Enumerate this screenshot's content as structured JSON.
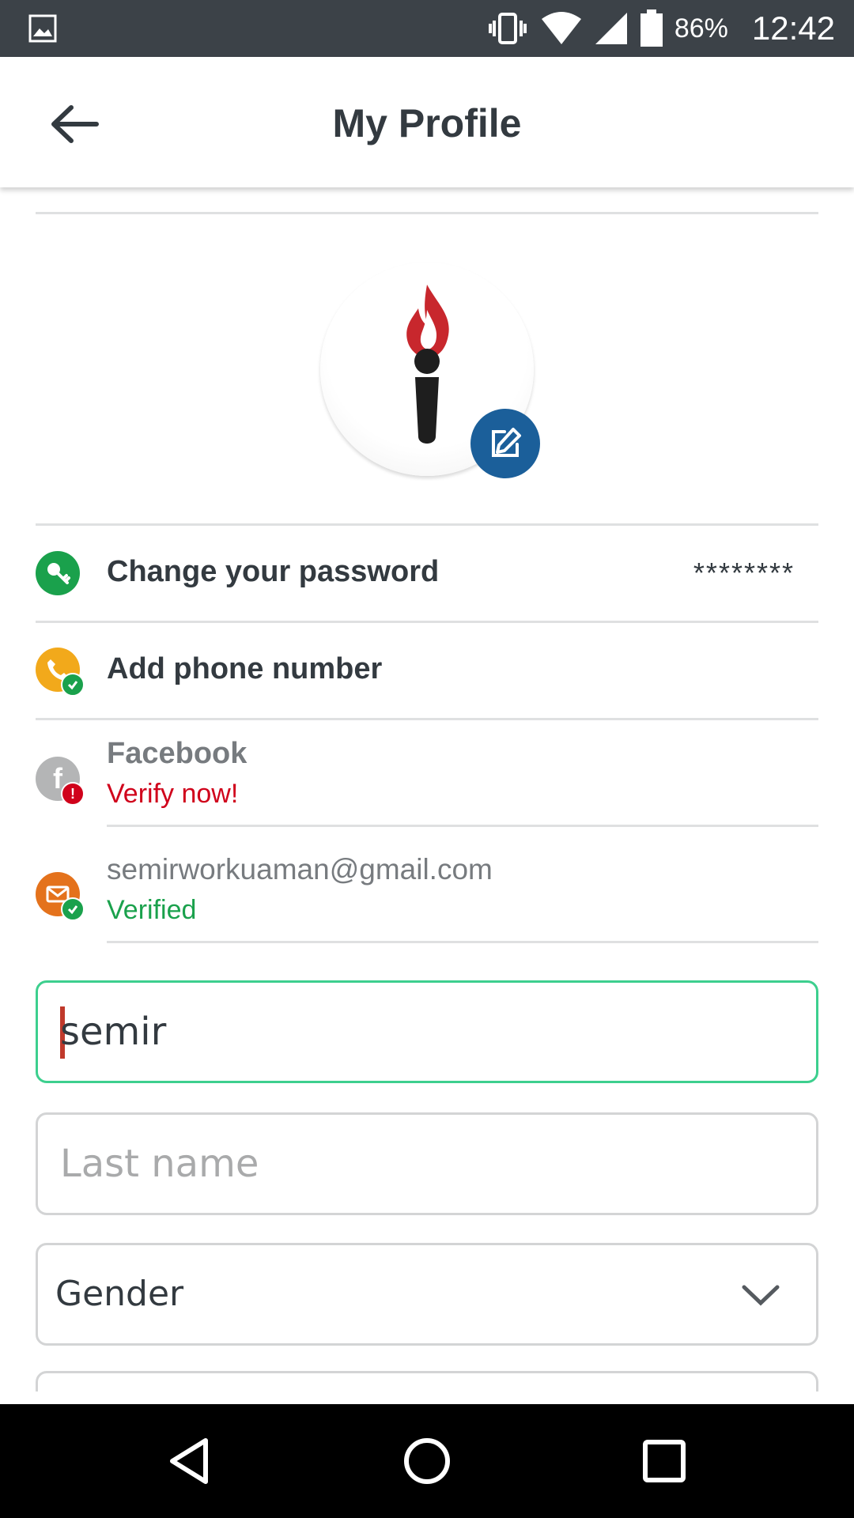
{
  "status_bar": {
    "battery_percent": "86%",
    "time": "12:42"
  },
  "app_bar": {
    "title": "My Profile"
  },
  "rows": {
    "password": {
      "label": "Change your password",
      "value": "********",
      "icon_color": "#1aa14c"
    },
    "phone": {
      "label": "Add phone number",
      "icon_color": "#f2a91b",
      "badge_color": "#1aa14c"
    },
    "facebook": {
      "label": "Facebook",
      "status": "Verify now!",
      "status_color": "#d0021b",
      "icon_color": "#b4b5b6"
    },
    "email": {
      "label": "semirworkuaman@gmail.com",
      "status": "Verified",
      "status_color": "#1aa14c",
      "icon_color": "#e4721c"
    }
  },
  "form": {
    "first_name_value": "semir",
    "last_name_placeholder": "Last name",
    "gender_label": "Gender"
  },
  "colors": {
    "accent_blue": "#1b5f9a",
    "active_border": "#3dcf8e",
    "status_bar": "#3c4248"
  }
}
